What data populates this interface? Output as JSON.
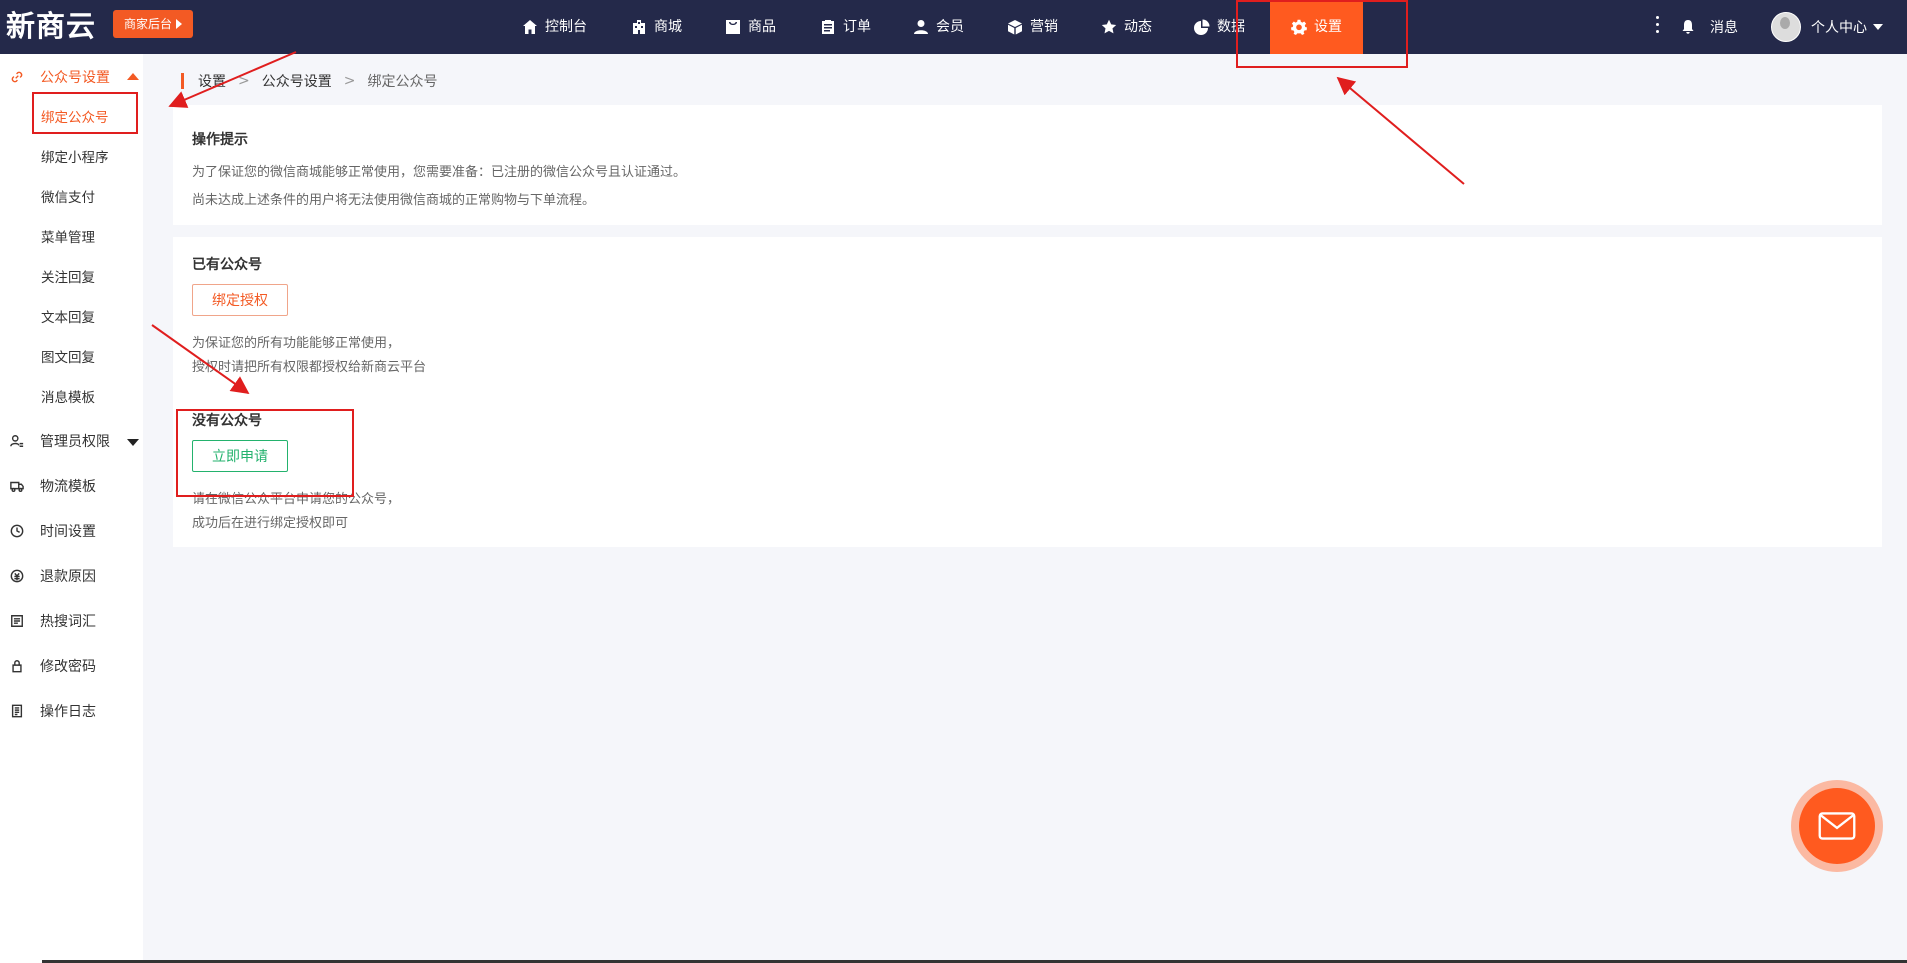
{
  "topbar": {
    "logo": "新商云",
    "merchant_button": "商家后台",
    "nav": [
      {
        "label": "控制台",
        "icon": "home-icon"
      },
      {
        "label": "商城",
        "icon": "building-icon"
      },
      {
        "label": "商品",
        "icon": "bag-icon"
      },
      {
        "label": "订单",
        "icon": "clipboard-icon"
      },
      {
        "label": "会员",
        "icon": "user-icon"
      },
      {
        "label": "营销",
        "icon": "cube-icon"
      },
      {
        "label": "动态",
        "icon": "star-icon"
      },
      {
        "label": "数据",
        "icon": "pie-chart-icon"
      },
      {
        "label": "设置",
        "icon": "gear-icon",
        "active": true
      }
    ],
    "messages_label": "消息",
    "profile_label": "个人中心"
  },
  "sidebar": {
    "groups": [
      {
        "label": "公众号设置",
        "icon": "link-icon",
        "expanded": true
      },
      {
        "label": "管理员权限",
        "icon": "admin-user-icon"
      },
      {
        "label": "物流模板",
        "icon": "truck-icon"
      },
      {
        "label": "时间设置",
        "icon": "clock-icon"
      },
      {
        "label": "退款原因",
        "icon": "refund-icon"
      },
      {
        "label": "热搜词汇",
        "icon": "list-icon"
      },
      {
        "label": "修改密码",
        "icon": "lock-icon"
      },
      {
        "label": "操作日志",
        "icon": "log-icon"
      }
    ],
    "sub_items": [
      "绑定公众号",
      "绑定小程序",
      "微信支付",
      "菜单管理",
      "关注回复",
      "文本回复",
      "图文回复",
      "消息模板"
    ],
    "active_sub": "绑定公众号"
  },
  "breadcrumb": [
    "设置",
    "公众号设置",
    "绑定公众号"
  ],
  "tips": {
    "title": "操作提示",
    "line1": "为了保证您的微信商城能够正常使用，您需要准备：已注册的微信公众号且认证通过。",
    "line2": "尚未达成上述条件的用户将无法使用微信商城的正常购物与下单流程。"
  },
  "has_account": {
    "title": "已有公众号",
    "button": "绑定授权",
    "line1": "为保证您的所有功能能够正常使用，",
    "line2": "授权时请把所有权限都授权给新商云平台"
  },
  "no_account": {
    "title": "没有公众号",
    "button": "立即申请",
    "line1": "请在微信公众平台申请您的公众号，",
    "line2": "成功后在进行绑定授权即可"
  },
  "colors": {
    "topbar": "#24294a",
    "accent": "#ff5a1f",
    "apply_green": "#23b26d",
    "annotation_red": "#e01e1e"
  }
}
